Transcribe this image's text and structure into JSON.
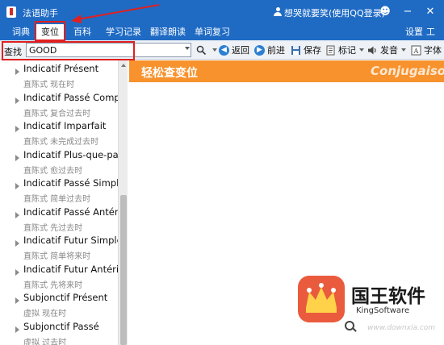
{
  "app": {
    "title": "法语助手",
    "user_label": "想哭就要笑(使用QQ登录)"
  },
  "window_controls": {
    "smiley": "☻",
    "minimize": "−",
    "close": "✕"
  },
  "menu": {
    "items": [
      "词典",
      "变位",
      "百科",
      "学习记录",
      "翻译朗读",
      "单词复习"
    ],
    "active_index": 1,
    "settings": "设置",
    "tools": "工具"
  },
  "toolbar": {
    "find_label": "查找",
    "search_value": "GOOD",
    "back": "返回",
    "forward": "前进",
    "save": "保存",
    "mark": "标记",
    "pronounce": "发音",
    "font": "字体"
  },
  "conjugation_list": [
    {
      "title": "Indicatif Présent",
      "sub": "直陈式 现在时"
    },
    {
      "title": "Indicatif Passé Composé",
      "sub": "直陈式 复合过去时"
    },
    {
      "title": "Indicatif Imparfait",
      "sub": "直陈式 未完成过去时"
    },
    {
      "title": "Indicatif Plus-que-parfait",
      "sub": "直陈式 愈过去时"
    },
    {
      "title": "Indicatif Passé Simple",
      "sub": "直陈式 简单过去时"
    },
    {
      "title": "Indicatif Passé Antérieur",
      "sub": "直陈式 先过去时"
    },
    {
      "title": "Indicatif Futur Simple",
      "sub": "直陈式 简单将来时"
    },
    {
      "title": "Indicatif Futur Antérieur",
      "sub": "直陈式 先将来时"
    },
    {
      "title": "Subjonctif Présent",
      "sub": "虚拟 现在时"
    },
    {
      "title": "Subjonctif Passé",
      "sub": "虚拟 过去时"
    }
  ],
  "banner": {
    "title": "轻松查变位",
    "right_text": "Conjugaison"
  },
  "watermark": {
    "title": "国王软件",
    "subtitle": "KingSoftware",
    "url": "www.downxia.com"
  },
  "colors": {
    "title_bar": "#1f6bc4",
    "banner": "#f7922d",
    "annotation_red": "#e02020",
    "watermark_badge": "#ea5b3e"
  }
}
